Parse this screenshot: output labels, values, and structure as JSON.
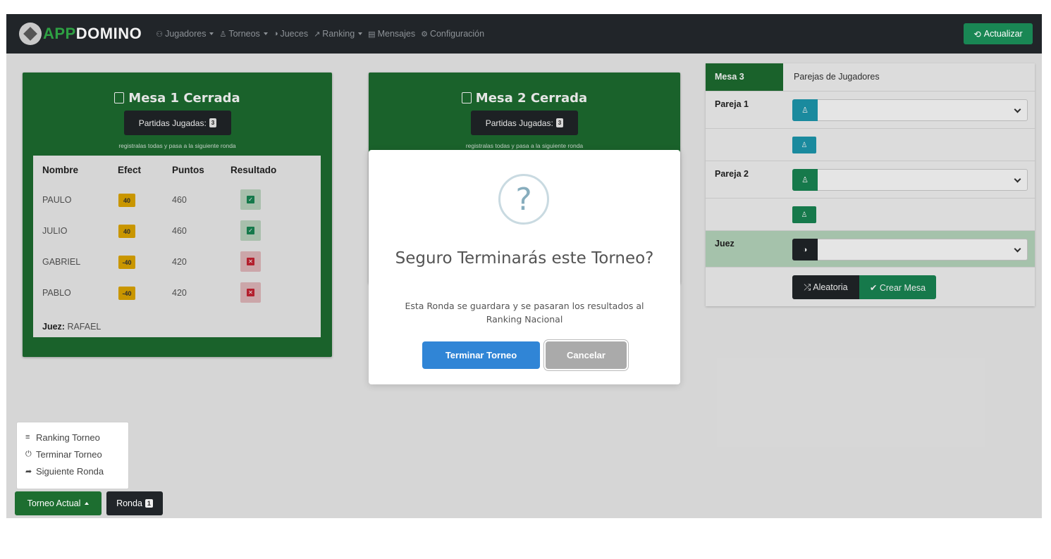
{
  "brand": {
    "part1": "APP",
    "part2": "DOMINO"
  },
  "nav": {
    "items": [
      {
        "icon": "users-icon",
        "glyph": "⚇",
        "label": "Jugadores",
        "caret": true
      },
      {
        "icon": "trophy-icon",
        "glyph": "♙",
        "label": "Torneos",
        "caret": true
      },
      {
        "icon": "shield-icon",
        "glyph": "◑",
        "label": "Jueces",
        "caret": false
      },
      {
        "icon": "chart-icon",
        "glyph": "↗",
        "label": "Ranking",
        "caret": true
      },
      {
        "icon": "message-icon",
        "glyph": "▤",
        "label": "Mensajes",
        "caret": false
      },
      {
        "icon": "settings-icon",
        "glyph": "⚙",
        "label": "Configuración",
        "caret": false
      }
    ],
    "refresh_label": "Actualizar"
  },
  "mesa1": {
    "title": "Mesa 1 Cerrada",
    "partidas_label": "Partidas Jugadas:",
    "partidas_count": "3",
    "subtext": "registralas todas y pasa a la siguiente ronda",
    "headers": [
      "Nombre",
      "Efect",
      "Puntos",
      "Resultado"
    ],
    "rows": [
      {
        "name": "PAULO",
        "efect": "40",
        "puntos": "460",
        "result": "win"
      },
      {
        "name": "JULIO",
        "efect": "40",
        "puntos": "460",
        "result": "win"
      },
      {
        "name": "GABRIEL",
        "efect": "-40",
        "puntos": "420",
        "result": "lose"
      },
      {
        "name": "PABLO",
        "efect": "-40",
        "puntos": "420",
        "result": "lose"
      }
    ],
    "juez_label": "Juez:",
    "juez_name": "RAFAEL"
  },
  "mesa2": {
    "title": "Mesa 2 Cerrada",
    "partidas_label": "Partidas Jugadas:",
    "partidas_count": "3",
    "subtext": "registralas todas y pasa a la siguiente ronda"
  },
  "mesa3": {
    "label": "Mesa 3",
    "header_text": "Parejas de Jugadores",
    "pareja1_label": "Pareja 1",
    "pareja2_label": "Pareja 2",
    "juez_label": "Juez",
    "random_label": "Aleatoria",
    "create_label": "Crear Mesa"
  },
  "modal": {
    "icon": "?",
    "title": "Seguro Terminarás este Torneo?",
    "text": "Esta Ronda se guardara y se pasaran los resultados al Ranking Nacional",
    "confirm_label": "Terminar Torneo",
    "cancel_label": "Cancelar"
  },
  "tournament_menu": {
    "items": [
      {
        "icon": "list-icon",
        "glyph": "≡",
        "label": "Ranking Torneo"
      },
      {
        "icon": "power-icon",
        "glyph": "⏻",
        "label": "Terminar Torneo"
      },
      {
        "icon": "share-icon",
        "glyph": "➦",
        "label": "Siguiente Ronda"
      }
    ],
    "current_label": "Torneo Actual",
    "round_label": "Ronda",
    "round_number": "1"
  },
  "colors": {
    "green": "#1d6e30",
    "success": "#198754",
    "teal": "#1d9ab0",
    "dark": "#212529",
    "warning": "#e0a800",
    "modal_blue": "#3085d6"
  }
}
